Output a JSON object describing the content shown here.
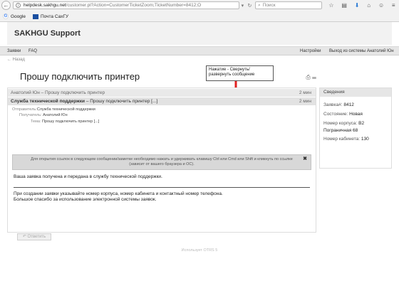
{
  "browser": {
    "url_host": "helpdesk.sakhgu.net",
    "url_path": "/customer.pl?Action=CustomerTicketZoom;TicketNumber=8412;O",
    "search_placeholder": "Поиск",
    "bookmarks": [
      {
        "label": "Google",
        "icon": "google-icon"
      },
      {
        "label": "Почта СахГУ",
        "icon": "mail-icon"
      }
    ]
  },
  "app": {
    "brand": "SAKHGU Support",
    "nav": {
      "tickets": "Заявки",
      "faq": "FAQ",
      "settings": "Настройки",
      "logout": "Выход из системы Анатолий Юн"
    },
    "back_link": "← Назад"
  },
  "ticket": {
    "title": "Прошу подключить принтер",
    "tooltip": "Нажатие - Свернуть/развернуть сообщение",
    "articles": [
      {
        "from": "Анатолий Юн",
        "subject": "– Прошу подключить принтер",
        "time": "2 мин"
      },
      {
        "from": "Служба технической поддержки",
        "subject": "– Прошу подключить принтер [...]",
        "time": "2 мин"
      }
    ],
    "meta": {
      "sender_label": "Отправитель:",
      "sender": "Служба технической поддержки",
      "recipient_label": "Получатель:",
      "recipient": "Анатолий Юн",
      "subject_label": "Тема:",
      "subject": "Прошу подключить принтер [...]"
    },
    "notice": "Для открытия ссылок в следующем сообщении/заметке необходимо нажать и удерживать клавишу Ctrl или Cmd или Shift и кликнуть по ссылке (зависит от вашего браузера и ОС).",
    "body": {
      "line1": "Ваша заявка получена и передана в службу технической поддержки.",
      "line2": "При создании заявки указывайте номер корпуса, номер кабинета и контактный номер телефона.",
      "line3": "Большое спасибо за использование электронной системы заявок."
    },
    "reply_label": "↶ Ответить"
  },
  "sidebar": {
    "heading": "Сведения",
    "rows": [
      {
        "label": "Заявка#:",
        "value": "8412"
      },
      {
        "label": "Состояние:",
        "value": "Новая"
      },
      {
        "label": "Номер корпуса:",
        "value": "B2"
      },
      {
        "label": "",
        "value": "Пограничная 68"
      },
      {
        "label": "Номер кабинета:",
        "value": "130"
      }
    ]
  },
  "footer": "Использует OTRS 5",
  "colors": {
    "arrow": "#e02020",
    "download": "#2a7ad5"
  }
}
